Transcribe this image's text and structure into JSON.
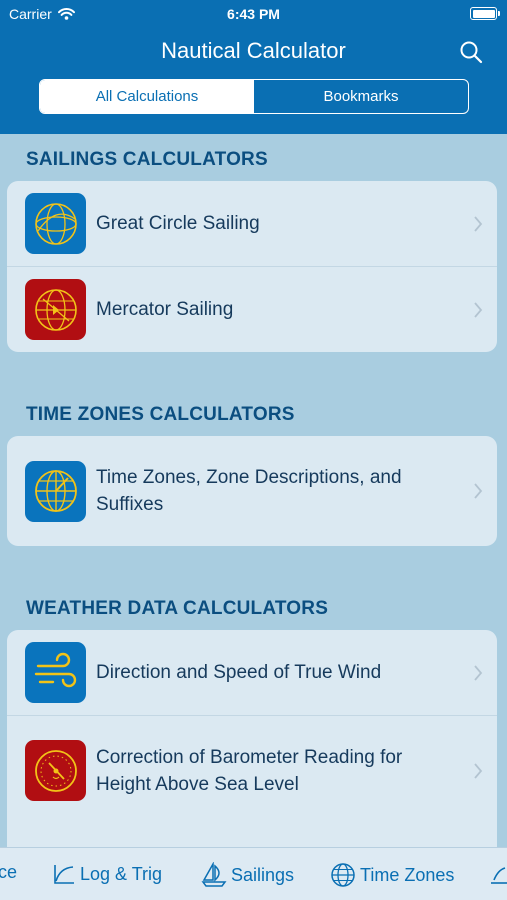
{
  "status_bar": {
    "carrier": "Carrier",
    "time": "6:43 PM"
  },
  "nav": {
    "title": "Nautical Calculator"
  },
  "segments": [
    {
      "label": "All Calculations",
      "active": true
    },
    {
      "label": "Bookmarks",
      "active": false
    }
  ],
  "sections": [
    {
      "title": "SAILINGS CALCULATORS",
      "items": [
        {
          "label": "Great Circle Sailing",
          "icon": "great-circle-globe-icon"
        },
        {
          "label": "Mercator Sailing",
          "icon": "mercator-globe-icon"
        }
      ]
    },
    {
      "title": "TIME ZONES CALCULATORS",
      "items": [
        {
          "label": "Time Zones, Zone Descriptions, and Suffixes",
          "icon": "time-zone-globe-icon"
        }
      ]
    },
    {
      "title": "WEATHER DATA CALCULATORS",
      "items": [
        {
          "label": "Direction and Speed of True Wind",
          "icon": "wind-icon"
        },
        {
          "label": "Correction of Barometer Reading for Height Above Sea Level",
          "icon": "barometer-icon"
        }
      ]
    }
  ],
  "tabbar": [
    {
      "label": "ce",
      "icon": ""
    },
    {
      "label": "Log & Trig",
      "icon": "log-curve-icon"
    },
    {
      "label": "Sailings",
      "icon": "sailboat-icon"
    },
    {
      "label": "Time Zones",
      "icon": "globe-icon"
    },
    {
      "label": "",
      "icon": "weather-icon"
    }
  ],
  "colors": {
    "header": "#0a6fb3",
    "background": "#a9cde0",
    "card": "#dbe9f2",
    "section_title": "#0b4e80",
    "icon_blue": "#0a74bd",
    "icon_red": "#b10e12",
    "icon_line": "#f2c318"
  }
}
